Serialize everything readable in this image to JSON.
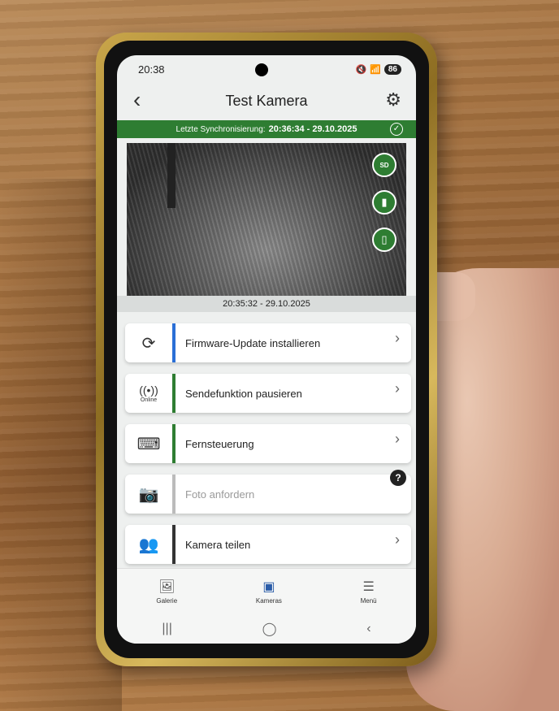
{
  "status_bar": {
    "time": "20:38",
    "battery": "86"
  },
  "header": {
    "title": "Test Kamera",
    "back_icon": "back-chevron-icon",
    "settings_icon": "gear-icon"
  },
  "sync": {
    "label": "Letzte Synchronisierung:",
    "value": "20:36:34 - 29.10.2025"
  },
  "preview": {
    "timestamp": "20:35:32 - 29.10.2025",
    "badges": [
      "sd-card-icon",
      "signal-icon",
      "battery-icon"
    ],
    "badge_labels": {
      "sd": "SD"
    }
  },
  "menu": {
    "items": [
      {
        "label": "Firmware-Update installieren",
        "icon": "update-icon",
        "accent": "#2a6fd6"
      },
      {
        "label": "Sendefunktion pausieren",
        "icon": "antenna-icon",
        "sub": "Online",
        "accent": "#2e7d32"
      },
      {
        "label": "Fernsteuerung",
        "icon": "remote-icon",
        "accent": "#2e7d32"
      },
      {
        "label": "Foto anfordern",
        "icon": "camera-icon",
        "accent": "#bbbbbb",
        "disabled": true
      },
      {
        "label": "Kamera teilen",
        "icon": "group-icon",
        "accent": "#333333"
      }
    ]
  },
  "bottom_nav": {
    "items": [
      {
        "label": "Galerie",
        "icon": "gallery-icon"
      },
      {
        "label": "Kameras",
        "icon": "camera-device-icon",
        "active": true
      },
      {
        "label": "Menü",
        "icon": "hamburger-icon"
      }
    ]
  }
}
